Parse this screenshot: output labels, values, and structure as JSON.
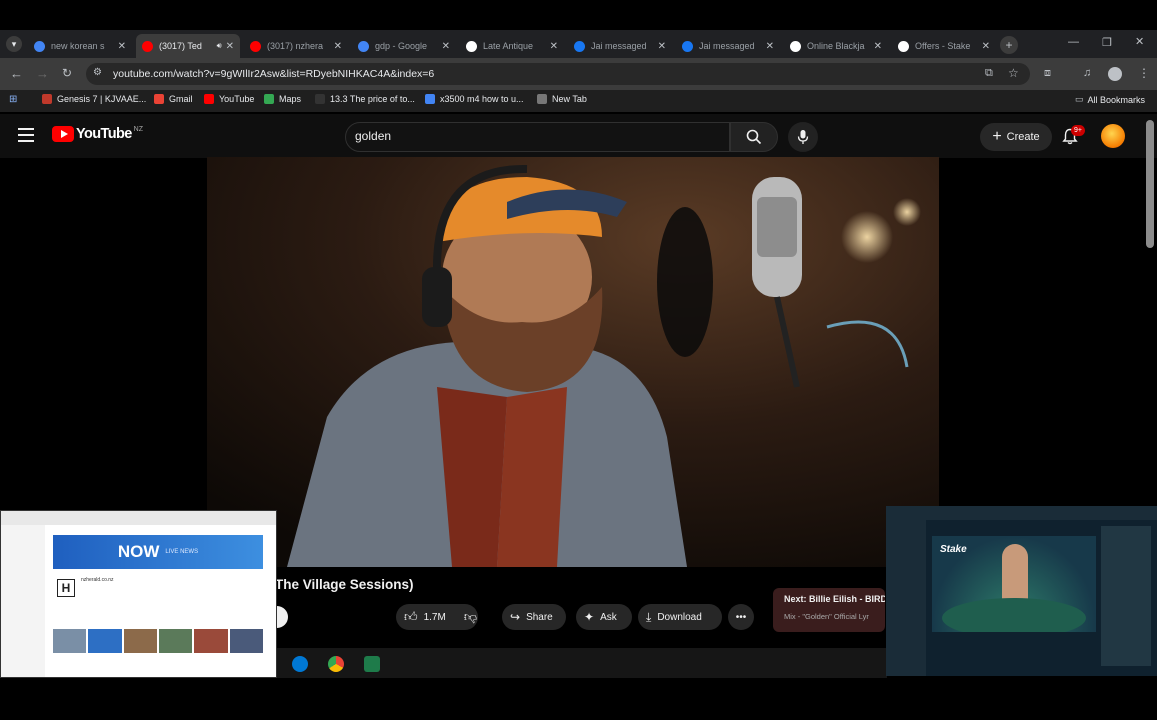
{
  "browser": {
    "tabs": [
      {
        "title": "new korean s",
        "favicon": "google-icon",
        "color": "#4285f4"
      },
      {
        "title": "(3017) Ted",
        "favicon": "youtube-icon",
        "color": "#ff0000",
        "active": true
      },
      {
        "title": "(3017) nzhera",
        "favicon": "youtube-icon",
        "color": "#ff0000"
      },
      {
        "title": "gdp - Google",
        "favicon": "google-icon",
        "color": "#4285f4"
      },
      {
        "title": "Late Antique",
        "favicon": "wikipedia-icon",
        "color": "#ffffff"
      },
      {
        "title": "Jai messaged",
        "favicon": "facebook-icon",
        "color": "#1877f2"
      },
      {
        "title": "Jai messaged",
        "favicon": "facebook-icon",
        "color": "#1877f2"
      },
      {
        "title": "Online Blackja",
        "favicon": "stake-icon",
        "color": "#ffffff"
      },
      {
        "title": "Offers - Stake",
        "favicon": "stake-icon",
        "color": "#ffffff"
      }
    ],
    "url": "youtube.com/watch?v=9gWIlIr2Asw&list=RDyebNIHKAC4A&index=6",
    "bookmarks": [
      {
        "label": "Genesis 7 | KJVAAE...",
        "color": "#c0392b"
      },
      {
        "label": "Gmail",
        "color": "#ea4335"
      },
      {
        "label": "YouTube",
        "color": "#ff0000"
      },
      {
        "label": "Maps",
        "color": "#34a853"
      },
      {
        "label": "13.3 The price of to...",
        "color": "#333333"
      },
      {
        "label": "x3500 m4 how to u...",
        "color": "#4285f4"
      },
      {
        "label": "New Tab",
        "color": "#777777"
      }
    ],
    "all_bookmarks": "All Bookmarks"
  },
  "youtube": {
    "logo_text": "YouTube",
    "region": "NZ",
    "search_value": "golden",
    "create_label": "Create",
    "notification_count": "9+",
    "video_title": "The Village Sessions)",
    "likes": "1.7M",
    "share_label": "Share",
    "ask_label": "Ask",
    "download_label": "Download",
    "next_label": "Next: Billie Eilish - BIRD",
    "next_sub": "Mix - \"Golden\" Official Lyr"
  },
  "pip_left": {
    "banner": "NOW",
    "banner_sub": "LIVE NEWS",
    "site": "nzherald.co.nz"
  },
  "pip_right": {
    "logo": "Stake"
  }
}
